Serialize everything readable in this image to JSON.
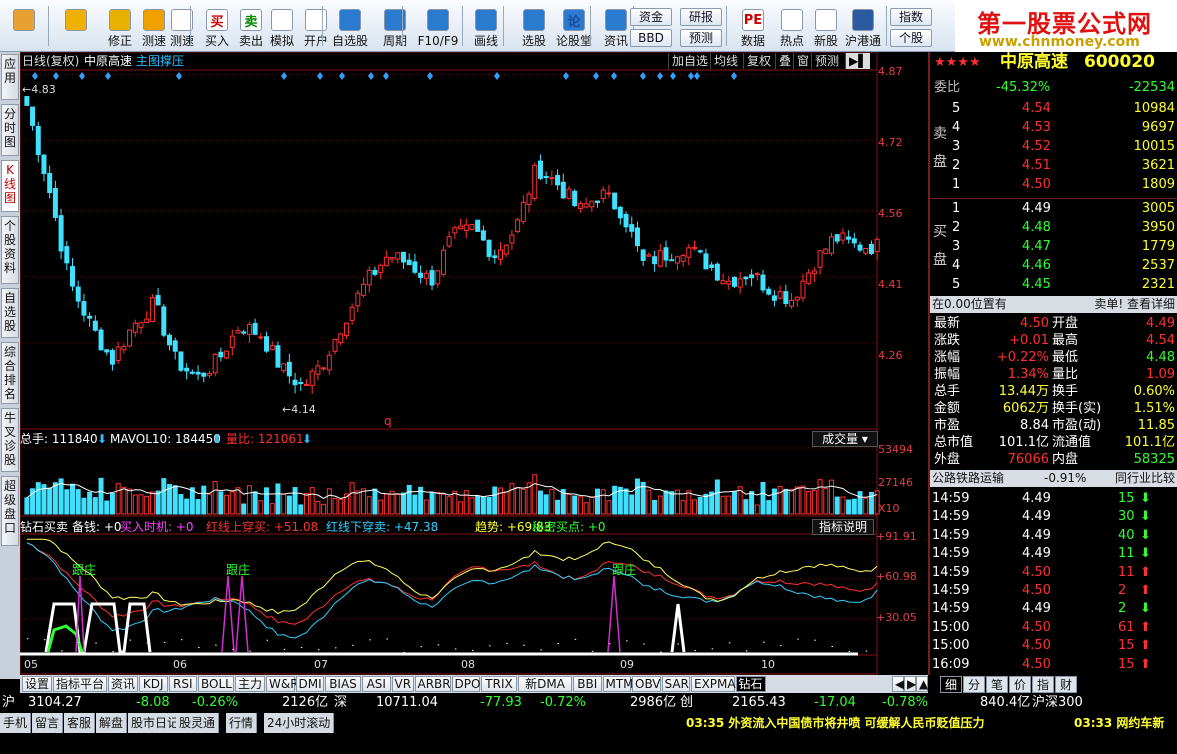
{
  "toolbar": {
    "buttons": [
      {
        "label": "",
        "icon": "system-icon"
      },
      {
        "label": "",
        "icon": "back-arrow-icon"
      },
      {
        "label": "修正",
        "icon": "up-arrow-icon"
      },
      {
        "label": "测速",
        "icon": "speed-icon"
      },
      {
        "label": "测速",
        "icon": "clock-icon"
      },
      {
        "label": "买入",
        "icon": "buy-icon",
        "glyph": "买"
      },
      {
        "label": "卖出",
        "icon": "sell-icon",
        "glyph": "卖"
      },
      {
        "label": "模拟",
        "icon": "hammer-icon"
      },
      {
        "label": "开户",
        "icon": "lock-icon"
      },
      {
        "label": "自选股",
        "icon": "star-icon"
      },
      {
        "label": "周期",
        "icon": "period-icon"
      },
      {
        "label": "F10/F9",
        "icon": "f10-icon"
      },
      {
        "label": "画线",
        "icon": "pen-icon"
      },
      {
        "label": "选股",
        "icon": "monitor-icon"
      },
      {
        "label": "论股堂",
        "icon": "forum-icon",
        "glyph": "论"
      },
      {
        "label": "资讯",
        "icon": "news-icon"
      },
      {
        "label": "数据",
        "icon": "data-icon",
        "glyph": "PE"
      },
      {
        "label": "热点",
        "icon": "fire-icon"
      },
      {
        "label": "新股",
        "icon": "doc-icon"
      },
      {
        "label": "沪港通",
        "icon": "hkconnect-icon"
      }
    ],
    "small": {
      "fund": "资金",
      "research": "研报",
      "bbd": "BBD",
      "forecast": "预测",
      "index": "指数",
      "stock": "个股",
      "extra": "»"
    }
  },
  "watermark": {
    "title": "第一股票公式网",
    "url": "www.chnmoney.com"
  },
  "sidetabs": [
    "应用",
    "分时图",
    "K线图",
    "个股资料",
    "自选股",
    "综合排名",
    "牛叉诊股",
    "超级盘口"
  ],
  "kline": {
    "title": "日线(复权)",
    "stock": "中原高速",
    "pattern": "主图撑压",
    "tabs": [
      "加自选",
      "均线",
      "复权",
      "叠",
      "窗",
      "预测"
    ],
    "hi_label": "4.83",
    "lo_label": "4.14",
    "marker": "q",
    "price_ticks": [
      "4.87",
      "4.72",
      "4.56",
      "4.41",
      "4.26"
    ],
    "vol_header": {
      "total": "总手: 111840",
      "mavol": "MAVOL10: 184450",
      "ratio": "量比: 121061",
      "button": "成交量"
    },
    "vol_ticks": [
      "53494",
      "27146",
      "X10"
    ],
    "ind_header": {
      "name": "钻石买卖",
      "a": "备钱: +0",
      "b": "买入时机: +0",
      "c": "红线上穿买: +51.08",
      "d": "红线下穿卖: +47.38",
      "e": "趋势: +69.83",
      "f": "秘密买点: +0",
      "button": "指标说明"
    },
    "ind_ticks": [
      "+91.91",
      "+60.98",
      "+30.05"
    ],
    "ind_labels": [
      "跟庄",
      "跟庄",
      "跟庄"
    ],
    "months": [
      "05",
      "06",
      "07",
      "08",
      "09",
      "10"
    ]
  },
  "chart_data": {
    "type": "candlestick",
    "title": "中原高速 日线(复权)",
    "ylim": [
      4.08,
      4.88
    ],
    "x": [
      "05",
      "06",
      "07",
      "08",
      "09",
      "10"
    ],
    "high_point": 4.83,
    "low_point": 4.14
  },
  "bottom_tabs": [
    "设置",
    "指标平台",
    "资讯",
    "KDJ",
    "RSI",
    "BOLL",
    "主力",
    "W&R",
    "DMI",
    "BIAS",
    "ASI",
    "VR",
    "ARBR",
    "DPO",
    "TRIX",
    "新DMA",
    "BBI",
    "MTM",
    "OBV",
    "SAR",
    "EXPMA",
    "钻石"
  ],
  "right": {
    "stars": "★★★★",
    "name": "中原高速",
    "code": "600020",
    "weibi_label": "委比",
    "weibi": "-45.32%",
    "weicha": "-22534",
    "sell_label": "卖盘",
    "buy_label": "买盘",
    "sell": [
      {
        "lvl": "5",
        "price": "4.54",
        "vol": "10984"
      },
      {
        "lvl": "4",
        "price": "4.53",
        "vol": "9697"
      },
      {
        "lvl": "3",
        "price": "4.52",
        "vol": "10015"
      },
      {
        "lvl": "2",
        "price": "4.51",
        "vol": "3621"
      },
      {
        "lvl": "1",
        "price": "4.50",
        "vol": "1809"
      }
    ],
    "buy": [
      {
        "lvl": "1",
        "price": "4.49",
        "vol": "3005"
      },
      {
        "lvl": "2",
        "price": "4.48",
        "vol": "3950"
      },
      {
        "lvl": "3",
        "price": "4.47",
        "vol": "1779"
      },
      {
        "lvl": "4",
        "price": "4.46",
        "vol": "2537"
      },
      {
        "lvl": "5",
        "price": "4.45",
        "vol": "2321"
      }
    ],
    "pos_text": "在0.00位置有",
    "pos_link": "卖单! 查看详细",
    "stats": [
      {
        "k1": "最新",
        "v1": "4.50",
        "k2": "开盘",
        "v2": "4.49"
      },
      {
        "k1": "涨跌",
        "v1": "+0.01",
        "k2": "最高",
        "v2": "4.54"
      },
      {
        "k1": "涨幅",
        "v1": "+0.22%",
        "k2": "最低",
        "v2": "4.48"
      },
      {
        "k1": "振幅",
        "v1": "1.34%",
        "k2": "量比",
        "v2": "1.09"
      },
      {
        "k1": "总手",
        "v1": "13.44万",
        "k2": "换手",
        "v2": "0.60%"
      },
      {
        "k1": "金额",
        "v1": "6062万",
        "k2": "换手(实)",
        "v2": "1.51%"
      },
      {
        "k1": "市盈",
        "v1": "8.84",
        "k2": "市盈(动)",
        "v2": "11.85"
      },
      {
        "k1": "总市值",
        "v1": "101.1亿",
        "k2": "流通值",
        "v2": "101.1亿"
      },
      {
        "k1": "外盘",
        "v1": "76066",
        "k2": "内盘",
        "v2": "58325"
      }
    ],
    "industry": "公路铁路运输",
    "industry_pct": "-0.91%",
    "compare": "同行业比较",
    "ticks": [
      {
        "t": "14:59",
        "p": "4.49",
        "v": "15",
        "d": "down"
      },
      {
        "t": "14:59",
        "p": "4.49",
        "v": "30",
        "d": "down"
      },
      {
        "t": "14:59",
        "p": "4.49",
        "v": "40",
        "d": "down"
      },
      {
        "t": "14:59",
        "p": "4.49",
        "v": "11",
        "d": "down"
      },
      {
        "t": "14:59",
        "p": "4.50",
        "v": "11",
        "d": "up"
      },
      {
        "t": "14:59",
        "p": "4.50",
        "v": "2",
        "d": "up"
      },
      {
        "t": "14:59",
        "p": "4.49",
        "v": "2",
        "d": "down"
      },
      {
        "t": "15:00",
        "p": "4.50",
        "v": "61",
        "d": "up"
      },
      {
        "t": "15:00",
        "p": "4.50",
        "v": "15",
        "d": "up"
      },
      {
        "t": "16:09",
        "p": "4.50",
        "v": "15",
        "d": "up"
      }
    ],
    "tabs": [
      "细",
      "分",
      "笔",
      "价",
      "指",
      "财"
    ]
  },
  "status": {
    "sh_label": "沪",
    "sh_index": "3104.27",
    "sh_chg": "-8.08",
    "sh_pct": "-0.26%",
    "sh_amt": "2126亿",
    "sz_label": "深",
    "sz_index": "10711.04",
    "sz_chg": "-77.93",
    "sz_pct": "-0.72%",
    "sz_amt": "2986亿",
    "cy_label": "创",
    "cy_index": "2165.43",
    "cy_chg": "-17.04",
    "cy_pct": "-0.78%",
    "hs_amt": "840.4亿",
    "hs_label": "沪深300",
    "menus": [
      "手机",
      "留言",
      "客服",
      "解盘",
      "股市日记",
      "股灵通",
      "行情",
      "24小时滚动"
    ],
    "news1": "03:35 外资流入中国债市将井喷 可缓解人民币贬值压力",
    "news2": "03:33 网约车新"
  }
}
